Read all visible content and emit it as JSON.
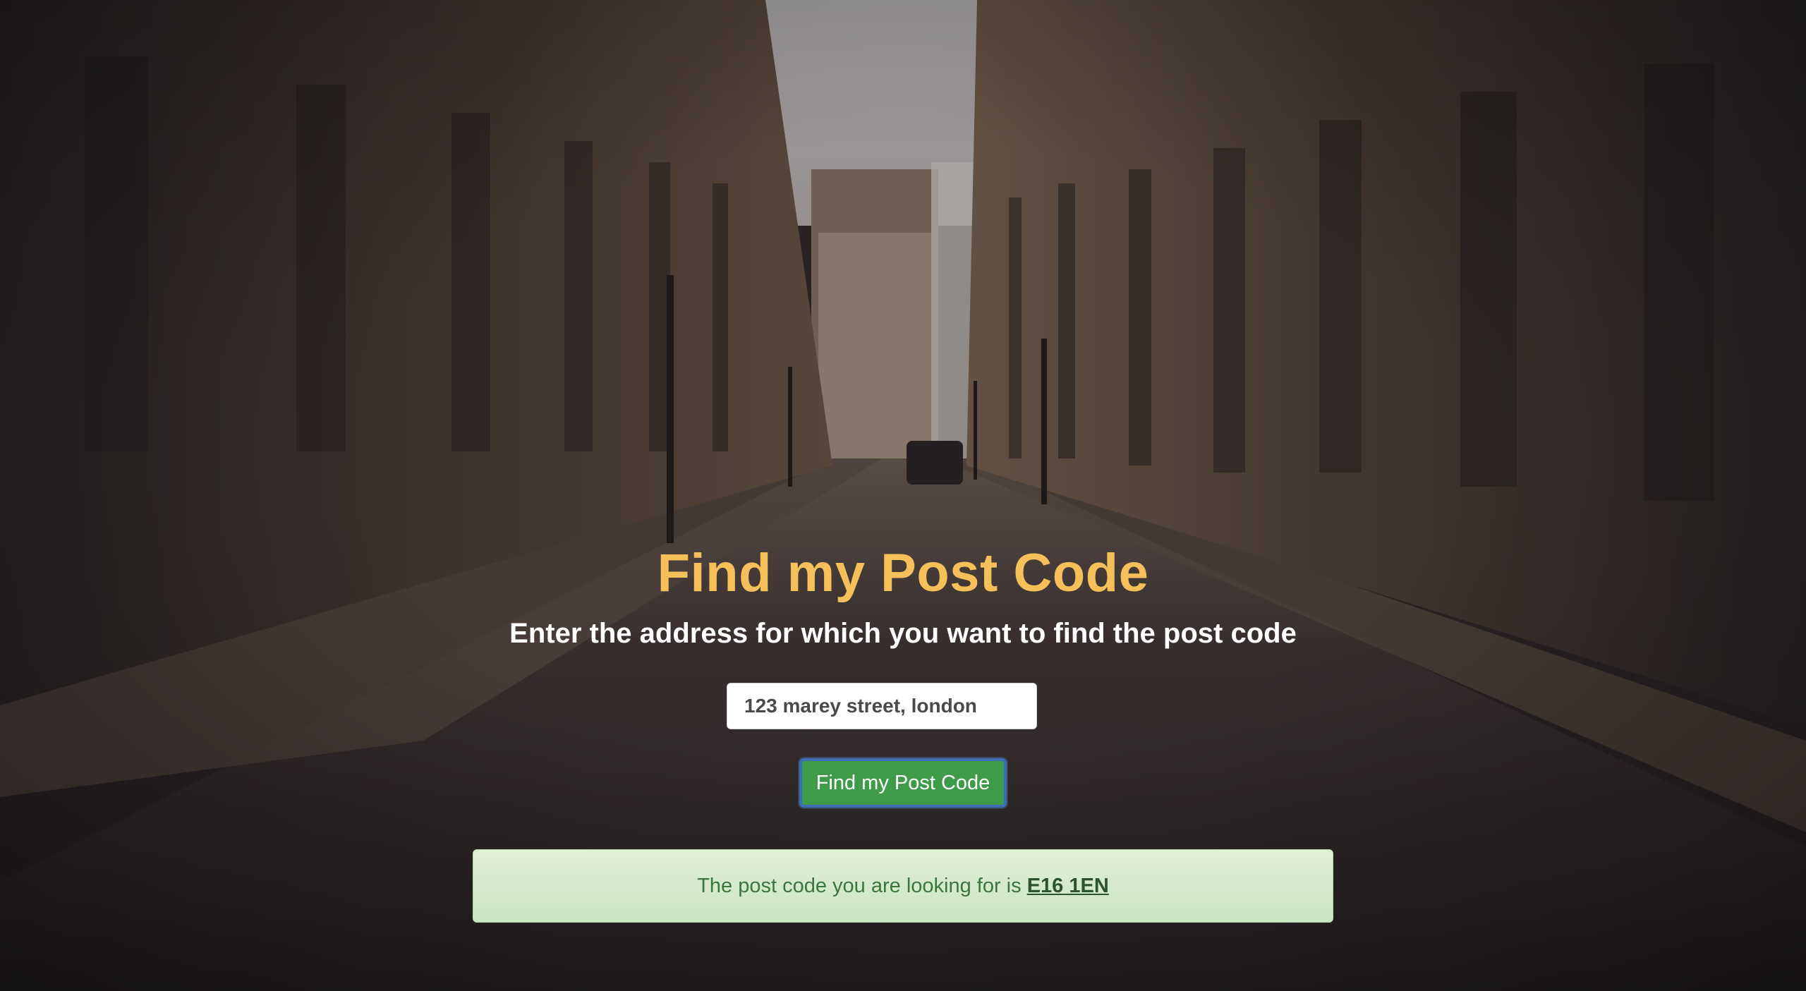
{
  "page": {
    "title": "Find my Post Code",
    "subtitle": "Enter the address for which you want to find the post code"
  },
  "form": {
    "address_value": "123 marey street, london",
    "submit_label": "Find my Post Code"
  },
  "result": {
    "message": "The post code you are looking for is",
    "postcode": "E16 1EN"
  },
  "colors": {
    "title": "#f5c05a",
    "button": "#3e9c48",
    "alert_bg": "#dff0d8",
    "alert_text": "#3c763d"
  }
}
